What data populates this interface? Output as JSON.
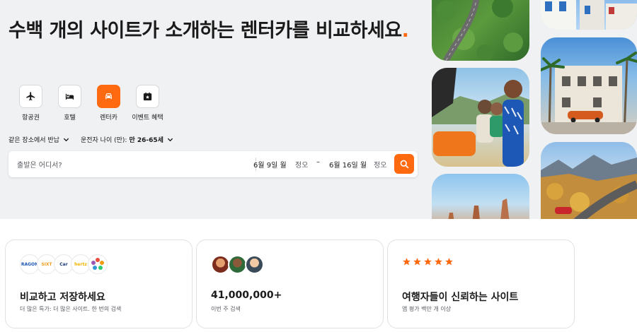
{
  "headline": {
    "text": "수백 개의 사이트가 소개하는 렌터카를 비교하세요",
    "dot": "."
  },
  "vertical_tabs": [
    {
      "label": "항공권",
      "icon": "plane-icon",
      "active": false
    },
    {
      "label": "호텔",
      "icon": "bed-icon",
      "active": false
    },
    {
      "label": "렌터카",
      "icon": "car-icon",
      "active": true
    },
    {
      "label": "이벤트 혜택",
      "icon": "gift-icon",
      "active": false
    }
  ],
  "options": {
    "return_same_place": "같은 장소에서 반납",
    "driver_age_label": "운전자 나이 (만):",
    "driver_age_value": "만 26-65세"
  },
  "search": {
    "where_placeholder": "출발은 어디서?",
    "pickup_date": "6월 9일 월",
    "pickup_time": "정오",
    "separator": "–",
    "dropoff_date": "6월 16일 월",
    "dropoff_time": "정오",
    "search_icon": "search-icon"
  },
  "cards": [
    {
      "title": "비교하고 저장하세요",
      "subtitle": "더 많은 특가: 더 많은 사이트. 한 번의 검색",
      "logos": [
        "RAGON",
        "SIXT",
        "Car",
        "hertz",
        "color"
      ]
    },
    {
      "title": "41,000,000+",
      "subtitle": "이번 주 검색"
    },
    {
      "title": "여행자들이 신뢰하는 사이트",
      "subtitle": "앱 평가 백만 개 이상",
      "stars": 5
    }
  ],
  "colors": {
    "accent": "#ff690f",
    "hero_bg": "#f0f1f3",
    "star": "#ff690f"
  }
}
